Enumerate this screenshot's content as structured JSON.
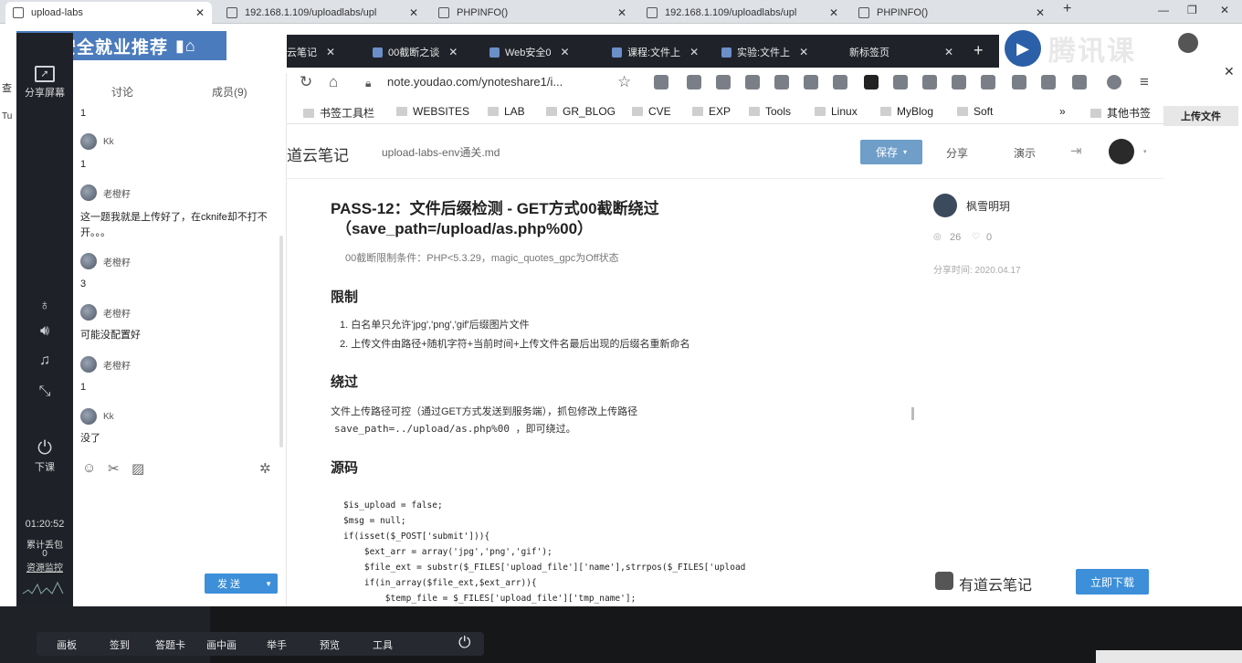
{
  "outer_tabs": [
    {
      "label": "upload-labs"
    },
    {
      "label": "192.168.1.109/uploadlabs/upl"
    },
    {
      "label": "PHPINFO()"
    },
    {
      "label": "192.168.1.109/uploadlabs/upl"
    },
    {
      "label": "PHPINFO()"
    }
  ],
  "banner": {
    "text": "网络安全就业推荐"
  },
  "tencent": {
    "brand": "腾讯课"
  },
  "rail": {
    "share_screen": "分享屏幕",
    "leave": "下课",
    "time": "01:20:52",
    "stats_label": "累计丢包",
    "stats_value": "0",
    "resource_link": "资源监控"
  },
  "chat": {
    "tab_discuss": "讨论",
    "tab_members": "成员(9)",
    "messages": [
      {
        "user": "",
        "text": "1"
      },
      {
        "user": "Kk",
        "text": "1"
      },
      {
        "user": "老橙籽",
        "text": "这一题我就是上传好了，在cknife却不打不开。。。"
      },
      {
        "user": "老橙籽",
        "text": "3"
      },
      {
        "user": "老橙籽",
        "text": "可能没配置好"
      },
      {
        "user": "老橙籽",
        "text": "1"
      },
      {
        "user": "Kk",
        "text": "没了"
      }
    ],
    "send_label": "发 送"
  },
  "inner_tabs": [
    {
      "label": "云笔记"
    },
    {
      "label": "00截断之谈"
    },
    {
      "label": "Web安全0"
    },
    {
      "label": "课程:文件上"
    },
    {
      "label": "实验:文件上"
    },
    {
      "label": "新标签页"
    }
  ],
  "address": {
    "url": "note.youdao.com/ynoteshare1/i..."
  },
  "bookmarks": [
    "书签工具栏",
    "WEBSITES",
    "LAB",
    "GR_BLOG",
    "CVE",
    "EXP",
    "Tools",
    "Linux",
    "MyBlog",
    "Soft",
    "其他书签"
  ],
  "upload_side_btn": "上传文件",
  "note": {
    "app_name": "道云笔记",
    "file_name": "upload-labs-env通关.md",
    "save": "保存",
    "share": "分享",
    "present": "演示"
  },
  "doc": {
    "title_line1": "PASS-12：文件后缀检测 - GET方式00截断绕过",
    "title_line2": "（save_path=/upload/as.php%00）",
    "subtitle": "00截断限制条件：PHP<5.3.29，magic_quotes_gpc为Off状态",
    "section_limit": "限制",
    "limit_items": [
      "1. 白名单只允许'jpg','png','gif'后缀图片文件",
      "2. 上传文件由路径+随机字符+当前时间+上传文件名最后出现的后缀名重新命名"
    ],
    "section_bypass": "绕过",
    "bypass_line1": "文件上传路径可控（通过GET方式发送到服务端），抓包修改上传路径",
    "bypass_line2": "save_path=../upload/as.php%00 ，即可绕过。",
    "section_source": "源码",
    "code_lines": [
      "$is_upload = false;",
      "$msg = null;",
      "if(isset($_POST['submit'])){",
      "    $ext_arr = array('jpg','png','gif');",
      "    $file_ext = substr($_FILES['upload_file']['name'],strrpos($_FILES['upload",
      "    if(in_array($file_ext,$ext_arr)){",
      "        $temp_file = $_FILES['upload_file']['tmp_name'];"
    ]
  },
  "author": {
    "name": "枫雪明玥",
    "views": "26",
    "likes": "0",
    "share_time": "分享时间: 2020.04.17"
  },
  "promo": {
    "brand": "有道云笔记",
    "download": "立即下载"
  },
  "bottom_bar": [
    "画板",
    "签到",
    "答题卡",
    "画中画",
    "举手",
    "预览",
    "工具"
  ],
  "colors": {
    "accent": "#3c8fd8",
    "dark": "#1f2329",
    "banner": "#4a7bbd",
    "save_btn": "#6f9ec9"
  }
}
